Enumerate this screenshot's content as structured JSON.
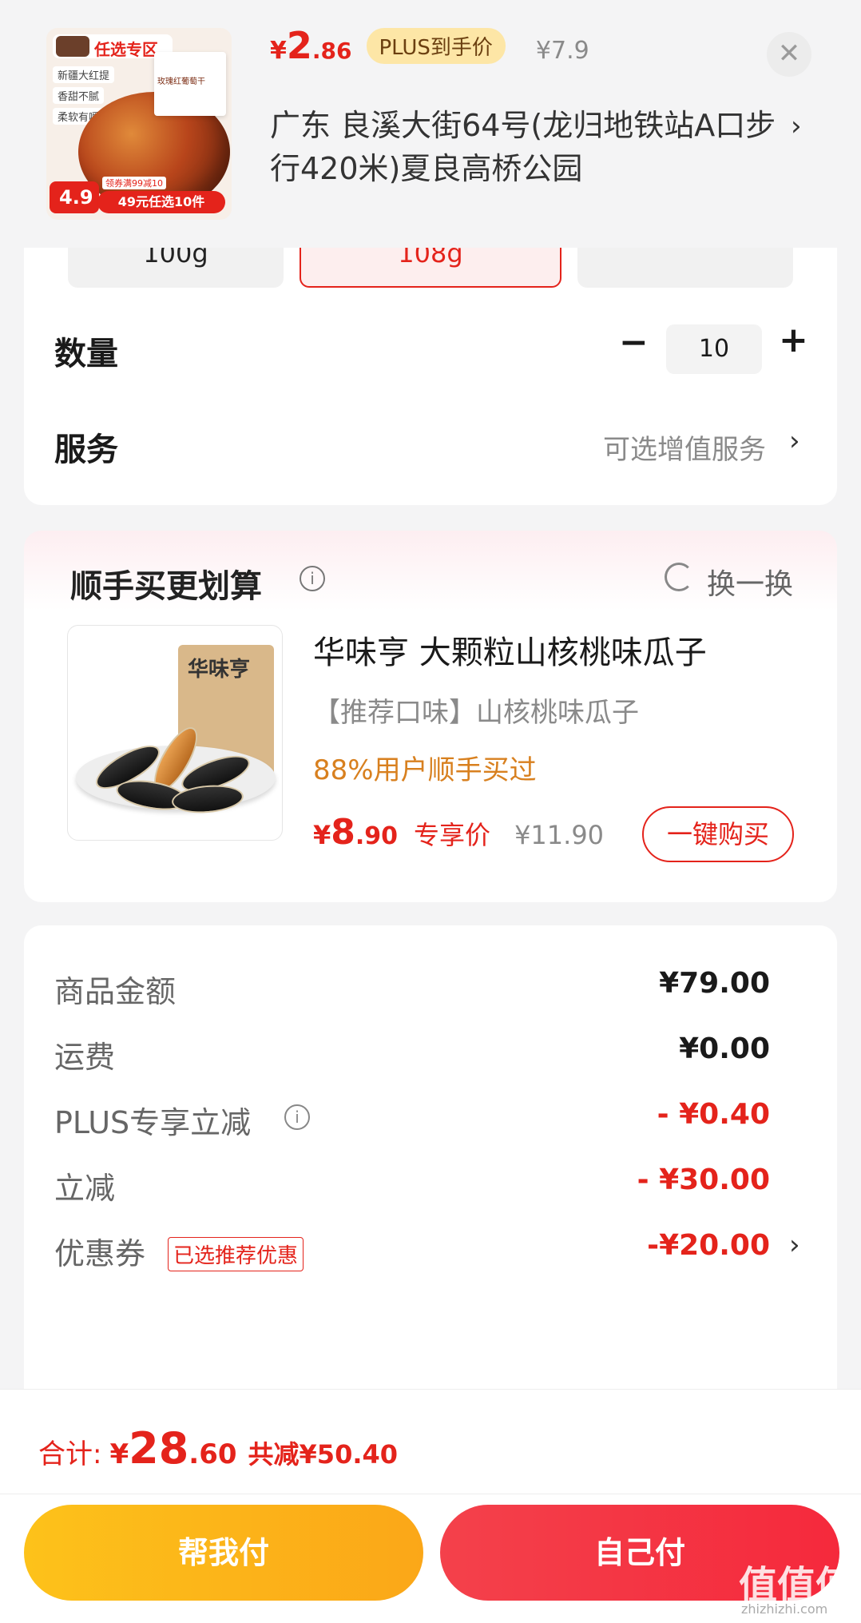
{
  "header": {
    "product_image": {
      "badge_top": "任选专区",
      "tags": [
        "新疆大红提",
        "香甜不腻",
        "柔软有嚼劲"
      ],
      "package_label": "玫瑰红葡萄干",
      "score": "4.9",
      "coupon_hint": "领券满99减10",
      "promo": "49元任选10件"
    },
    "price_currency": "¥",
    "price_int": "2",
    "price_dec": ".86",
    "plus_label": "PLUS到手价",
    "original_price": "¥7.9",
    "close_symbol": "✕",
    "address": "广东  良溪大街64号(龙归地铁站A口步行420米)夏良高桥公园",
    "address_chevron": "›"
  },
  "spec": {
    "sku_options": [
      "100g",
      "108g",
      ""
    ],
    "quantity_label": "数量",
    "quantity_minus": "−",
    "quantity_value": "10",
    "quantity_plus": "+",
    "service_label": "服务",
    "service_value": "可选增值服务",
    "service_chevron": "›"
  },
  "recommendation": {
    "title": "顺手买更划算",
    "info_symbol": "i",
    "refresh_label": "换一换",
    "product_bag_title": "华味亨",
    "product_name": "华味亨 大颗粒山核桃味瓜子",
    "flavor": "【推荐口味】山核桃味瓜子",
    "bought": "88%用户顺手买过",
    "price_currency": "¥",
    "price_int": "8",
    "price_dec": ".90",
    "exclusive_label": "专享价",
    "original_price": "¥11.90",
    "buy_button": "一键购买"
  },
  "summary": {
    "goods_label": "商品金额",
    "goods_value": "¥79.00",
    "shipping_label": "运费",
    "shipping_value": "¥0.00",
    "plus_label": "PLUS专享立减",
    "plus_value": "- ¥0.40",
    "discount_label": "立减",
    "discount_value": "- ¥30.00",
    "coupon_label": "优惠券",
    "coupon_tag": "已选推荐优惠",
    "coupon_value": "-¥20.00",
    "coupon_chevron": "›",
    "info_symbol": "i"
  },
  "bottom": {
    "total_label": "合计:",
    "total_currency": "¥",
    "total_int": "28",
    "total_dec": ".60",
    "total_saved": "共减¥50.40",
    "help_pay": "帮我付",
    "self_pay": "自己付",
    "watermark": "值值值",
    "watermark_sub": "zhizhizhi.com"
  },
  "colors": {
    "accent_red": "#e4231b",
    "plus_gold": "#fde6a6",
    "help_pay_yellow": "#fdc21a",
    "self_pay_red": "#f5293c",
    "bought_orange": "#d8801f"
  },
  "icons": {
    "close": "close-icon",
    "info": "info-icon",
    "refresh": "refresh-icon",
    "chevron": "chevron-right-icon"
  }
}
